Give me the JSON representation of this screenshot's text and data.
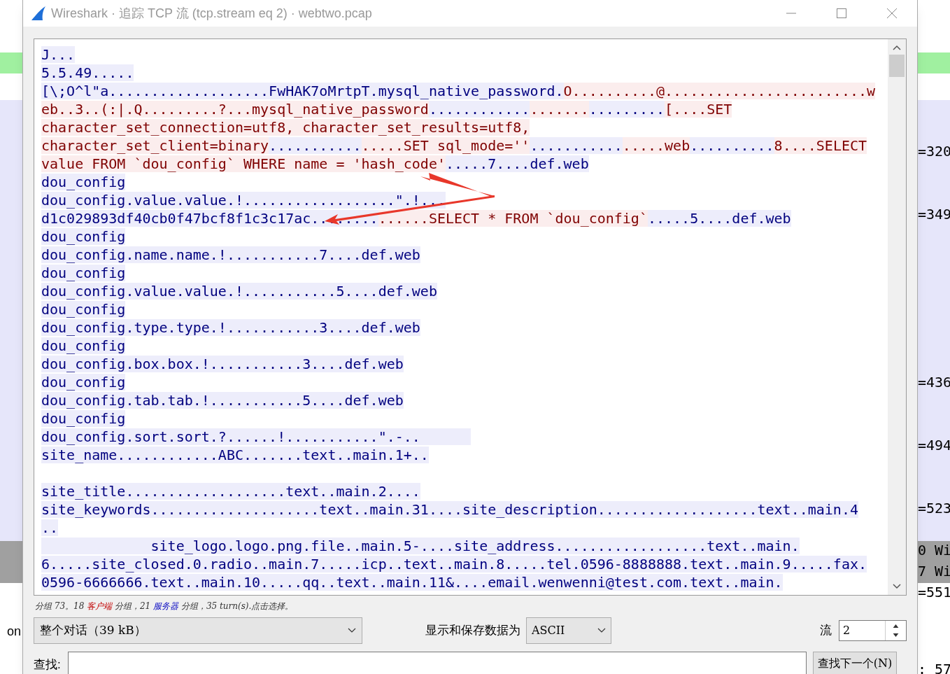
{
  "window": {
    "title": "Wireshark · 追踪 TCP 流 (tcp.stream eq 2) · webtwo.pcap"
  },
  "background": {
    "left_texts": [
      "on"
    ],
    "right_texts": [
      "=320",
      "=349",
      "=436",
      "=494",
      "=523",
      "0 Wi",
      "7 Wi",
      "=551",
      ": 57"
    ]
  },
  "stream": {
    "lines": [
      {
        "kind": "text",
        "segments": [
          {
            "kind": "server",
            "text": "J..."
          }
        ]
      },
      {
        "kind": "text",
        "segments": [
          {
            "kind": "server",
            "text": "5.5.49....."
          }
        ]
      },
      {
        "kind": "text",
        "segments": [
          {
            "kind": "server",
            "text": "[\\;O^l\"a...................FwHAK7oMrtpT.mysql_native_password."
          },
          {
            "kind": "client",
            "text": "O..........@........................w"
          }
        ]
      },
      {
        "kind": "text",
        "segments": [
          {
            "kind": "client",
            "text": "eb..3..(:|.Q.........?...mysql_native_password"
          },
          {
            "kind": "server",
            "text": "............"
          },
          {
            "kind": "client",
            "text": "......."
          },
          {
            "kind": "server",
            "text": "........."
          },
          {
            "kind": "client",
            "text": "[....SET"
          }
        ]
      },
      {
        "kind": "text",
        "segments": [
          {
            "kind": "client",
            "text": "character_set_connection=utf8, character_set_results=utf8,"
          }
        ]
      },
      {
        "kind": "text",
        "segments": [
          {
            "kind": "client",
            "text": "character_set_client=binary"
          },
          {
            "kind": "server",
            "text": "..........."
          },
          {
            "kind": "client",
            "text": ".....SET sql_mode=''"
          },
          {
            "kind": "server",
            "text": "..........."
          },
          {
            "kind": "client",
            "text": ".....web"
          },
          {
            "kind": "server",
            "text": ".........."
          },
          {
            "kind": "client",
            "text": "8....SELECT"
          }
        ]
      },
      {
        "kind": "text",
        "segments": [
          {
            "kind": "client",
            "text": "value FROM `dou_config` WHERE name = 'hash_code'"
          },
          {
            "kind": "server",
            "text": ".....7....def.web"
          }
        ]
      },
      {
        "kind": "text",
        "segments": [
          {
            "kind": "server",
            "text": "dou_config"
          }
        ]
      },
      {
        "kind": "text",
        "segments": [
          {
            "kind": "server",
            "text": "dou_config.value.value.!..................\".!..."
          }
        ]
      },
      {
        "kind": "text",
        "segments": [
          {
            "kind": "server",
            "text": "d1c029893df40cb0f47bcf8f1c3c17ac........"
          },
          {
            "kind": "client",
            "text": "......SELECT * FROM `dou_config`"
          },
          {
            "kind": "server",
            "text": ".....5....def.web"
          }
        ]
      },
      {
        "kind": "text",
        "segments": [
          {
            "kind": "server",
            "text": "dou_config"
          }
        ]
      },
      {
        "kind": "text",
        "segments": [
          {
            "kind": "server",
            "text": "dou_config.name.name.!...........7....def.web"
          }
        ]
      },
      {
        "kind": "text",
        "segments": [
          {
            "kind": "server",
            "text": "dou_config"
          }
        ]
      },
      {
        "kind": "text",
        "segments": [
          {
            "kind": "server",
            "text": "dou_config.value.value.!...........5....def.web"
          }
        ]
      },
      {
        "kind": "text",
        "segments": [
          {
            "kind": "server",
            "text": "dou_config"
          }
        ]
      },
      {
        "kind": "text",
        "segments": [
          {
            "kind": "server",
            "text": "dou_config.type.type.!...........3....def.web"
          }
        ]
      },
      {
        "kind": "text",
        "segments": [
          {
            "kind": "server",
            "text": "dou_config"
          }
        ]
      },
      {
        "kind": "text",
        "segments": [
          {
            "kind": "server",
            "text": "dou_config.box.box.!...........3....def.web"
          }
        ]
      },
      {
        "kind": "text",
        "segments": [
          {
            "kind": "server",
            "text": "dou_config"
          }
        ]
      },
      {
        "kind": "text",
        "segments": [
          {
            "kind": "server",
            "text": "dou_config.tab.tab.!...........5....def.web"
          }
        ]
      },
      {
        "kind": "text",
        "segments": [
          {
            "kind": "server",
            "text": "dou_config"
          }
        ]
      },
      {
        "kind": "text",
        "segments": [
          {
            "kind": "server",
            "text": "dou_config.sort.sort.?......!...........\".-..      "
          }
        ]
      },
      {
        "kind": "text",
        "segments": [
          {
            "kind": "server",
            "text": "site_name............ABC.......text..main.1+.."
          }
        ]
      },
      {
        "kind": "blank"
      },
      {
        "kind": "text",
        "segments": [
          {
            "kind": "server",
            "text": "site_title...................text..main.2...."
          }
        ]
      },
      {
        "kind": "text",
        "segments": [
          {
            "kind": "server",
            "text": "site_keywords....................text..main.31....site_description...................text..main.4"
          }
        ]
      },
      {
        "kind": "text",
        "segments": [
          {
            "kind": "server",
            "text": ".."
          }
        ]
      },
      {
        "kind": "text",
        "segments": [
          {
            "kind": "server",
            "text": "             site_logo.logo.png.file..main.5-....site_address..................text..main."
          }
        ]
      },
      {
        "kind": "text",
        "segments": [
          {
            "kind": "server",
            "text": "6.....site_closed.0.radio..main.7.....icp..text..main.8.....tel.0596-8888888.text..main.9.....fax."
          }
        ]
      },
      {
        "kind": "text",
        "segments": [
          {
            "kind": "server",
            "text": "0596-6666666.text..main.10.....qq..text..main.11&....email.wenwenni@test.com.text..main."
          }
        ]
      }
    ]
  },
  "status": [
    {
      "kind": "plain",
      "text": "分组 73。18 "
    },
    {
      "kind": "client",
      "text": "客户端"
    },
    {
      "kind": "plain",
      "text": " 分组，21 "
    },
    {
      "kind": "server",
      "text": "服务器"
    },
    {
      "kind": "plain",
      "text": " 分组，35 turn(s).点击选择。"
    }
  ],
  "conversation_select": {
    "value": "整个对话（39 kB）"
  },
  "format_label": "显示和保存数据为",
  "format_select": {
    "value": "ASCII"
  },
  "stream_label": "流",
  "stream_spin": {
    "value": "2"
  },
  "find_label": "查找:",
  "find_button": "查找下一个(N)"
}
